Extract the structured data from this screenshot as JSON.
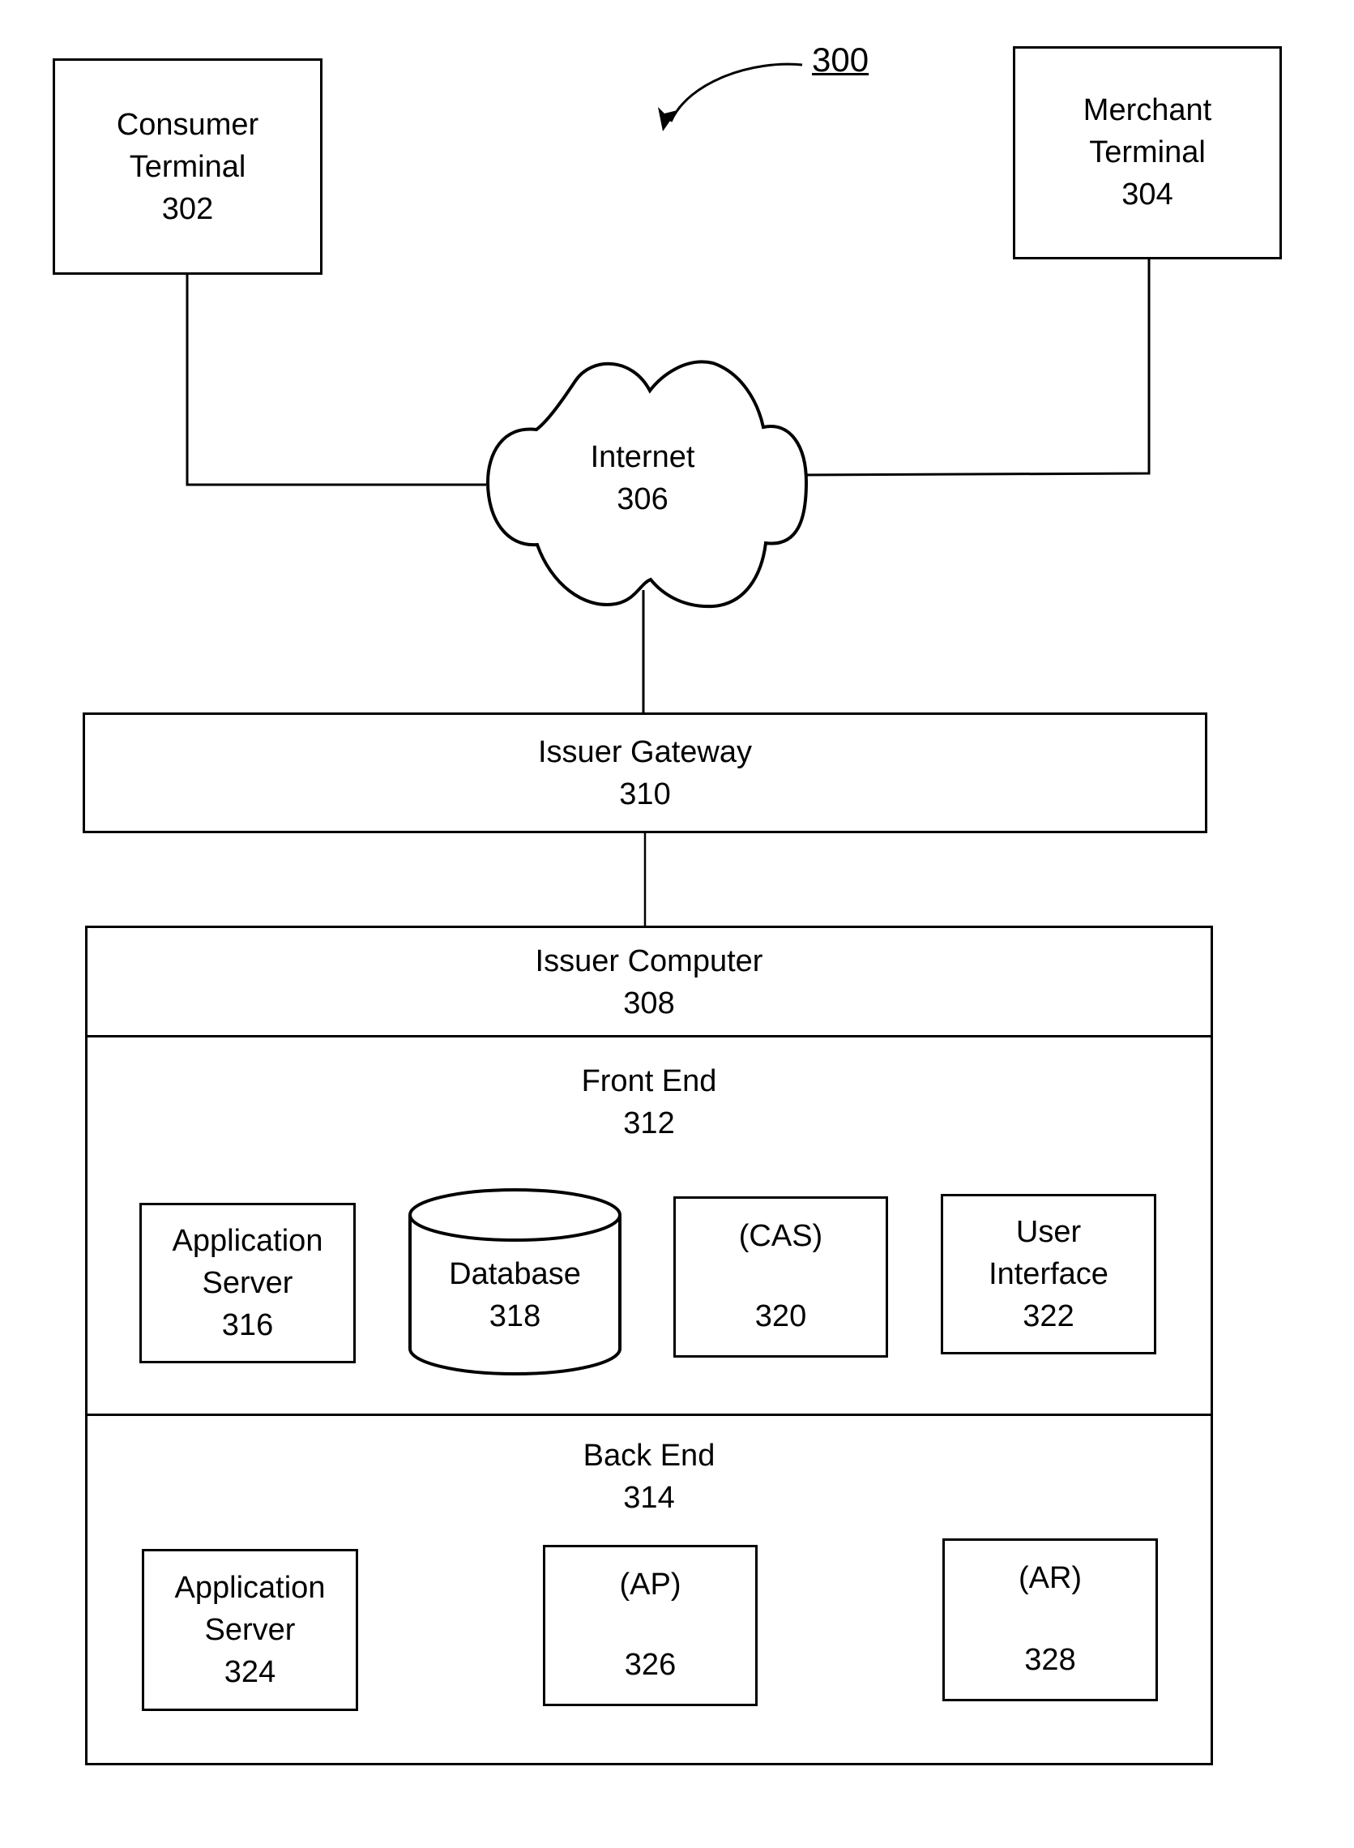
{
  "figure": {
    "reference": "300",
    "consumer_terminal": {
      "name_line1": "Consumer",
      "name_line2": "Terminal",
      "ref": "302"
    },
    "merchant_terminal": {
      "name_line1": "Merchant",
      "name_line2": "Terminal",
      "ref": "304"
    },
    "internet": {
      "name": "Internet",
      "ref": "306"
    },
    "issuer_gateway": {
      "name": "Issuer Gateway",
      "ref": "310"
    },
    "issuer_computer": {
      "name": "Issuer Computer",
      "ref": "308"
    },
    "front_end": {
      "name": "Front End",
      "ref": "312",
      "components": {
        "application_server": {
          "name_line1": "Application",
          "name_line2": "Server",
          "ref": "316"
        },
        "database": {
          "name": "Database",
          "ref": "318"
        },
        "cas": {
          "name": "(CAS)",
          "ref": "320"
        },
        "user_interface": {
          "name_line1": "User",
          "name_line2": "Interface",
          "ref": "322"
        }
      }
    },
    "back_end": {
      "name": "Back End",
      "ref": "314",
      "components": {
        "application_server": {
          "name_line1": "Application",
          "name_line2": "Server",
          "ref": "324"
        },
        "ap": {
          "name": "(AP)",
          "ref": "326"
        },
        "ar": {
          "name": "(AR)",
          "ref": "328"
        }
      }
    }
  }
}
